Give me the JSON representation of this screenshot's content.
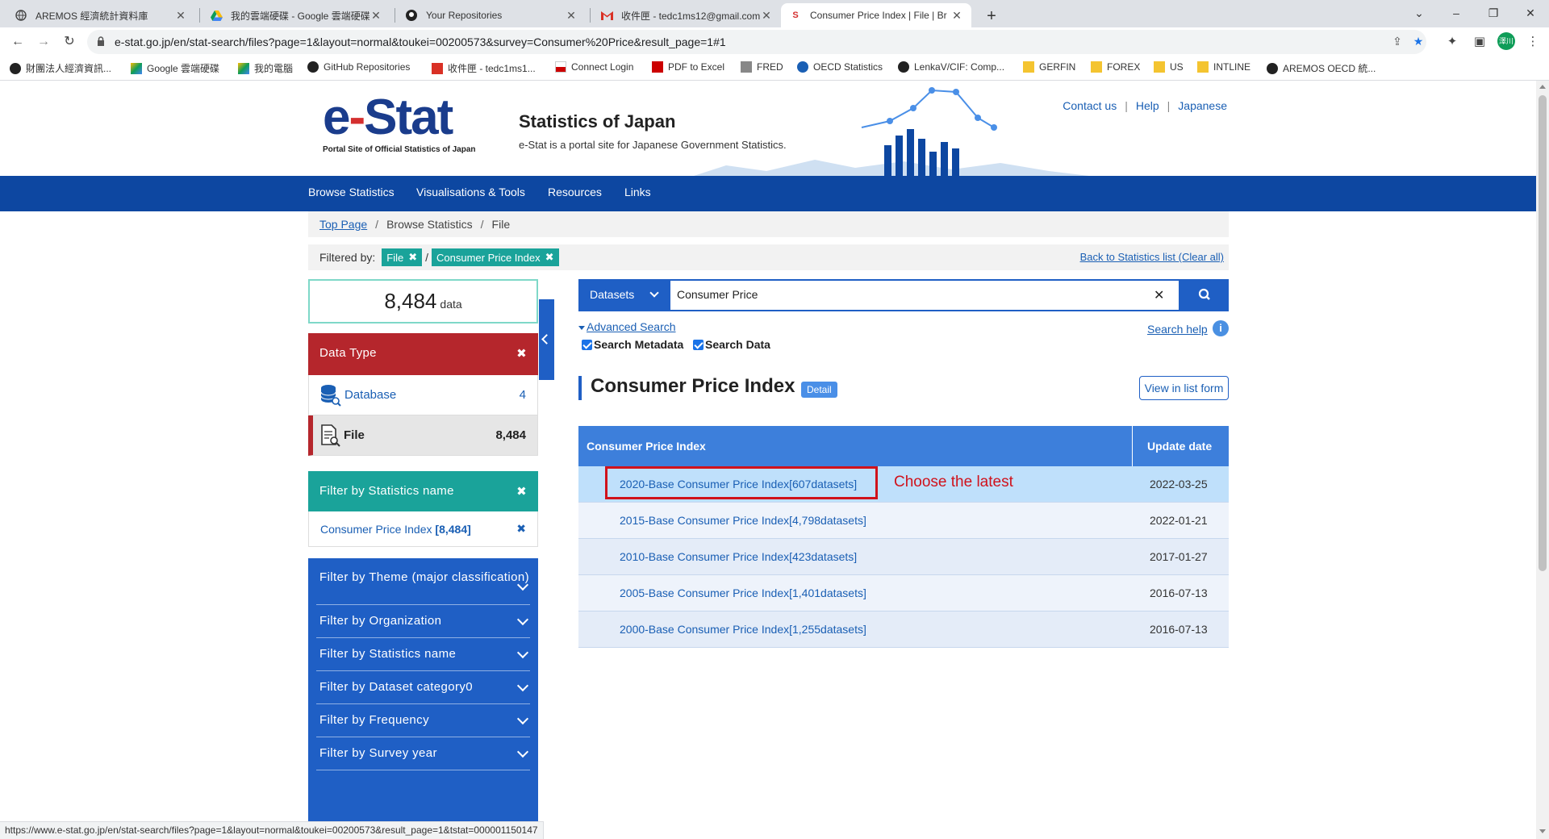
{
  "browser": {
    "tabs": [
      {
        "title": "AREMOS 經濟統計資料庫",
        "icon": "globe-icon"
      },
      {
        "title": "我的雲端硬碟 - Google 雲端硬碟",
        "icon": "drive-icon"
      },
      {
        "title": "Your Repositories",
        "icon": "github-icon"
      },
      {
        "title": "收件匣 - tedc1ms12@gmail.com",
        "icon": "gmail-icon"
      },
      {
        "title": "Consumer Price Index | File | Br",
        "icon": "estat-icon",
        "active": true
      }
    ],
    "url": "e-stat.go.jp/en/stat-search/files?page=1&layout=normal&toukei=00200573&survey=Consumer%20Price&result_page=1#1",
    "profile_label": "澤川",
    "bookmarks": [
      "財團法人經濟資訊...",
      "Google 雲端硬碟",
      "我的電腦",
      "GitHub Repositories",
      "收件匣 - tedc1ms1...",
      "Connect Login",
      "PDF to Excel",
      "FRED",
      "OECD Statistics",
      "LenkaV/CIF: Comp...",
      "GERFIN",
      "FOREX",
      "US",
      "INTLINE",
      "AREMOS OECD 統..."
    ],
    "status_url": "https://www.e-stat.go.jp/en/stat-search/files?page=1&layout=normal&toukei=00200573&result_page=1&tstat=000001150147"
  },
  "header": {
    "logo_text_e": "e",
    "logo_text_dash": "-",
    "logo_text_stat": "Stat",
    "logo_sub": "Portal Site of Official Statistics of Japan",
    "title": "Statistics of Japan",
    "description": "e-Stat is a portal site for Japanese Government Statistics.",
    "links": {
      "contact": "Contact us",
      "help": "Help",
      "japanese": "Japanese"
    }
  },
  "nav": [
    "Browse Statistics",
    "Visualisations & Tools",
    "Resources",
    "Links"
  ],
  "breadcrumb": {
    "top": "Top Page",
    "browse": "Browse Statistics",
    "current": "File"
  },
  "filtered": {
    "label": "Filtered by:",
    "chips": [
      "File",
      "Consumer Price Index"
    ],
    "back_link": "Back to Statistics list (Clear all)"
  },
  "sidebar": {
    "count": "8,484",
    "count_unit": "data",
    "data_type": {
      "title": "Data Type",
      "rows": [
        {
          "label": "Database",
          "count": "4"
        },
        {
          "label": "File",
          "count": "8,484"
        }
      ]
    },
    "stat_name_filter": {
      "title": "Filter by Statistics name",
      "item_label": "Consumer Price Index",
      "item_count": "[8,484]"
    },
    "filters": [
      "Filter by Theme (major classification)",
      "Filter by Organization",
      "Filter by Statistics name",
      "Filter by Dataset category0",
      "Filter by Frequency",
      "Filter by Survey year"
    ]
  },
  "search": {
    "scope": "Datasets",
    "query": "Consumer Price",
    "advanced": "Advanced Search",
    "check_metadata": "Search Metadata",
    "check_data": "Search Data",
    "help": "Search help",
    "help_icon_glyph": "i"
  },
  "results": {
    "title": "Consumer Price Index",
    "detail_badge": "Detail",
    "list_form": "View in list form",
    "col_name": "Consumer Price Index",
    "col_date": "Update date",
    "rows": [
      {
        "name": "2020-Base Consumer Price Index[607datasets]",
        "date": "2022-03-25"
      },
      {
        "name": "2015-Base Consumer Price Index[4,798datasets]",
        "date": "2022-01-21"
      },
      {
        "name": "2010-Base Consumer Price Index[423datasets]",
        "date": "2017-01-27"
      },
      {
        "name": "2005-Base Consumer Price Index[1,401datasets]",
        "date": "2016-07-13"
      },
      {
        "name": "2000-Base Consumer Price Index[1,255datasets]",
        "date": "2016-07-13"
      }
    ],
    "annotation": "Choose the latest"
  },
  "colors": {
    "nav_blue": "#0d47a1",
    "accent_blue": "#1f5fc5",
    "teal": "#1aa39a",
    "red": "#b5262c",
    "annotation_red": "#d0121b"
  }
}
